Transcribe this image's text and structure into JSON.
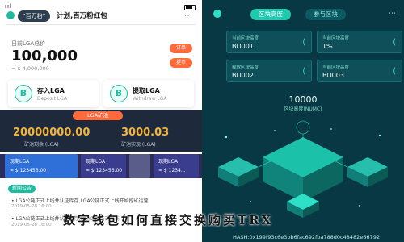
{
  "left": {
    "status": {
      "signal": "ııl"
    },
    "nav": {
      "pill": "“百万粉”",
      "title": "计划,百万粉红包",
      "menu": "⋯"
    },
    "balance": {
      "label": "日前LGA总价",
      "value": "100,000",
      "usd": "≈ $ 4,000,000",
      "btn_a": "订单",
      "btn_b": "提币"
    },
    "cards": [
      {
        "icon": "B",
        "title": "存入LGA",
        "sub": "Deposit LGA"
      },
      {
        "icon": "B",
        "title": "提取LGA",
        "sub": "Withdraw LGA"
      }
    ],
    "mining": {
      "pill": "LGA矿池",
      "left_value": "20000000.00",
      "left_label": "矿池剩余 (LGA)",
      "right_value": "3000.03",
      "right_label": "矿池实现 (LGA)"
    },
    "strip": {
      "tile1_label": "现期LGA",
      "tile1_amt": "≈ $ 123456.00",
      "tile2_label": "现期LGA",
      "tile2_amt": "≈ $ 123456.00",
      "tile4_label": "现期LGA",
      "tile4_amt": "≈ $ 1234..."
    },
    "news": {
      "tag": "新闻公告",
      "items": [
        {
          "text": "• LGA公链正式上线并认证库存,LGA公链正式上线开始挖矿运营",
          "date": "2019-05-28 16:00"
        },
        {
          "text": "• LGA公链正式上线并认证库存,LGA公链正式上线",
          "date": "2019-05-28 16:00"
        }
      ]
    }
  },
  "right": {
    "tabs": {
      "active": "区块高度",
      "inactive": "参与区块"
    },
    "menu": "⋯",
    "cards": [
      {
        "k": "当前区块高度",
        "v": "BO001"
      },
      {
        "k": "当前区块高度",
        "v": "1%"
      },
      {
        "k": "释放区块高度",
        "v": "BO002"
      },
      {
        "k": "当前区块高度",
        "v": "BO003"
      }
    ],
    "center": {
      "value": "10000",
      "label": "区块高度(NUMC)"
    },
    "hash": "HASH:0x199f93c6e3bb6fac692fba788d0c48482e66792"
  },
  "overlay_title": "数字钱包如何直接交换购买TRX",
  "colors": {
    "accent": "#1dbb9f",
    "orange": "#ff6a3d",
    "dark_teal": "#073843",
    "gold": "#f5b53d"
  }
}
